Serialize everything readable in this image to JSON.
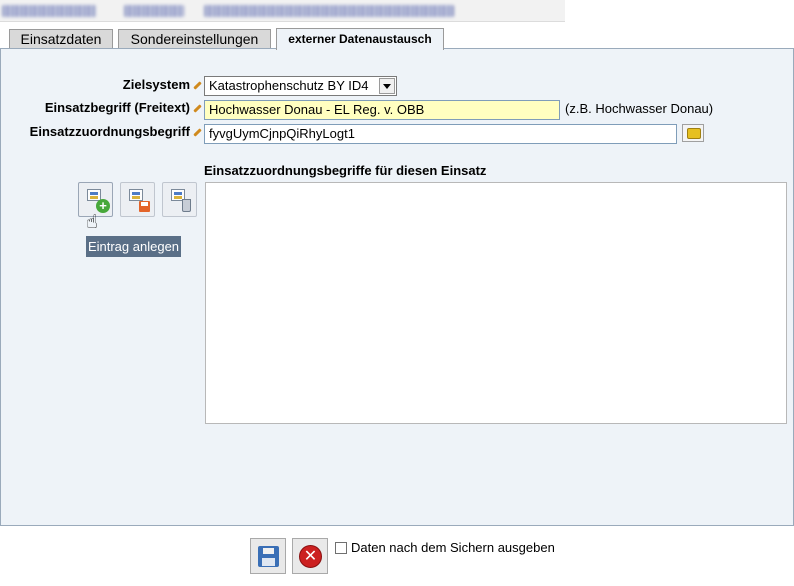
{
  "tabs": [
    {
      "label": "Einsatzdaten"
    },
    {
      "label": "Sondereinstellungen"
    },
    {
      "label": "externer Datenaustausch"
    }
  ],
  "form": {
    "zielsystem": {
      "label": "Zielsystem",
      "value": "Katastrophenschutz BY ID4"
    },
    "einsatzbegriff": {
      "label": "Einsatzbegriff (Freitext)",
      "value": "Hochwasser Donau - EL Reg. v. OBB",
      "hint": "(z.B. Hochwasser Donau)"
    },
    "zuordnungsbegriff": {
      "label": "Einsatzzuordnungsbegriff",
      "value": "fyvgUymCjnpQiRhyLogt1"
    }
  },
  "list": {
    "title": "Einsatzzuordnungsbegriffe für diesen Einsatz",
    "items": []
  },
  "tooltip": "Eintrag anlegen",
  "footer": {
    "checkbox_label": "Daten nach dem Sichern ausgeben",
    "checkbox_checked": false
  },
  "icons": [
    "add-entry-icon",
    "save-entry-icon",
    "delete-entry-icon",
    "key-icon",
    "hand-pointer-icon",
    "save-icon",
    "cancel-icon"
  ],
  "colors": {
    "panel": "#eef3f8",
    "highlight_input": "#ffffc0",
    "tooltip_bg": "#5a6f87"
  }
}
